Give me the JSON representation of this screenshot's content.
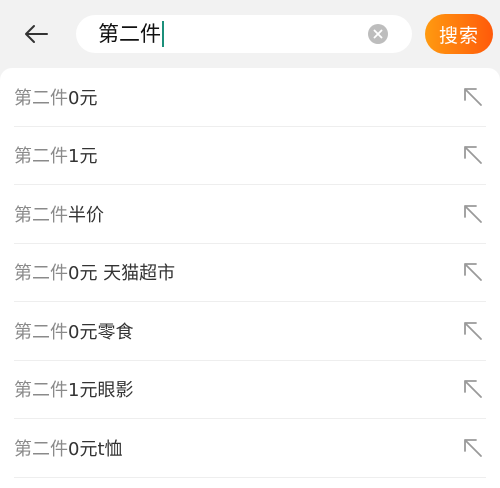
{
  "search": {
    "query": "第二件",
    "button_label": "搜索"
  },
  "suggestions": [
    {
      "query": "第二件",
      "rest": "0元"
    },
    {
      "query": "第二件",
      "rest": "1元"
    },
    {
      "query": "第二件",
      "rest": "半价"
    },
    {
      "query": "第二件",
      "rest": "0元 天猫超市"
    },
    {
      "query": "第二件",
      "rest": "0元零食"
    },
    {
      "query": "第二件",
      "rest": "1元眼影"
    },
    {
      "query": "第二件",
      "rest": "0元t恤"
    }
  ],
  "icons": {
    "back": "back-arrow-icon",
    "clear": "clear-icon",
    "fill": "fill-arrow-icon"
  },
  "colors": {
    "accent_start": "#ff9a10",
    "accent_end": "#ff5a0a",
    "caret": "#1b8f7a"
  }
}
